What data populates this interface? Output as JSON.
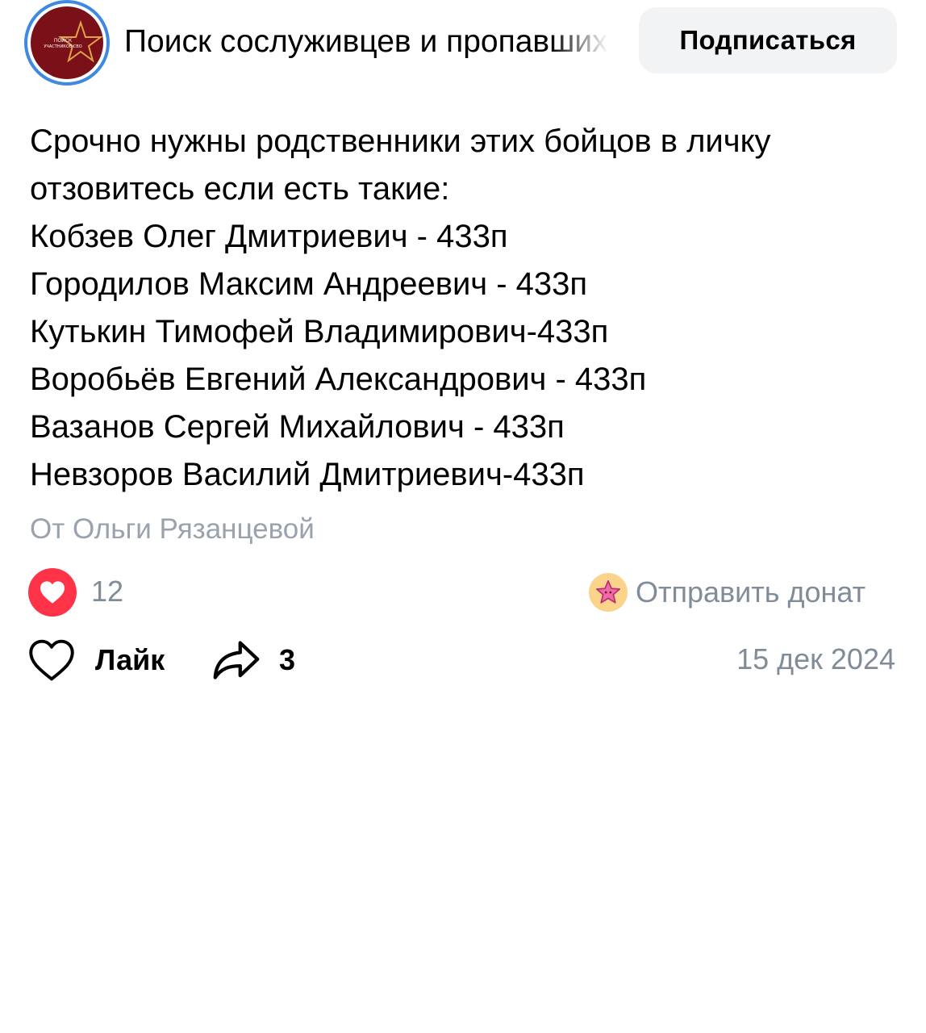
{
  "header": {
    "group_name": "Поиск сослуживцев и пропавших",
    "subscribe_label": "Подписаться",
    "avatar_text_line1": "ПОИСК",
    "avatar_text_line2": "УЧАСТНИКОВ СВО"
  },
  "post": {
    "lines": [
      "Срочно нужны родственники этих бойцов в личку",
      "отзовитесь если есть такие:",
      "Кобзев Олег Дмитриевич - 433п",
      "Городилов Максим Андреевич - 433п",
      "Кутькин Тимофей Владимирович-433п",
      "Воробьёв Евгений Александрович - 433п",
      "Вазанов Сергей Михайлович - 433п",
      "Невзоров Василий Дмитриевич-433п"
    ],
    "author": "От Ольги Рязанцевой"
  },
  "reactions": {
    "count": "12",
    "donate_label": "Отправить донат"
  },
  "actions": {
    "like_label": "Лайк",
    "share_count": "3",
    "date": "15 дек 2024"
  },
  "colors": {
    "accent_blue": "#3f8ae0",
    "like_red": "#ff3347",
    "secondary_text": "#818c99",
    "author_text": "#99a2ad",
    "button_bg": "#f2f3f5",
    "avatar_bg": "#7a1018"
  },
  "icons": {
    "reaction": "heart-filled-icon",
    "donate": "star-badge-icon",
    "like": "heart-outline-icon",
    "share": "share-arrow-icon"
  }
}
